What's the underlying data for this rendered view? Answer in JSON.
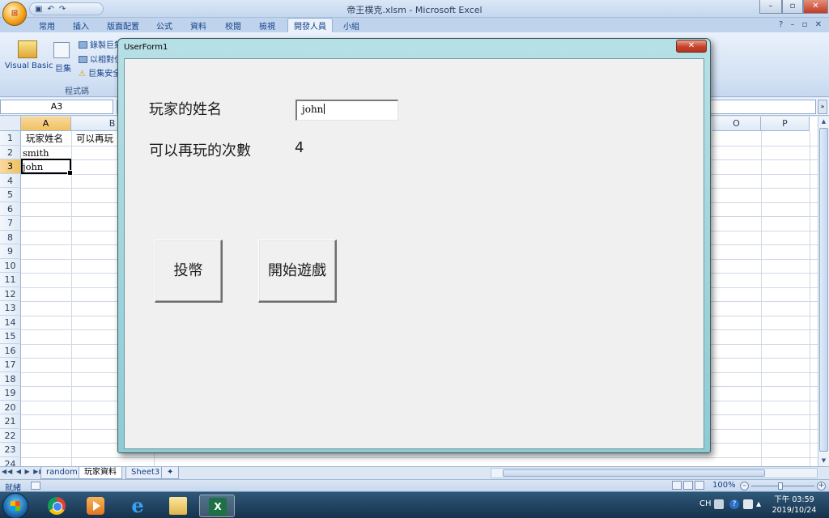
{
  "window": {
    "title": "帝王樸克.xlsm - Microsoft Excel",
    "office_button_label": "Office",
    "qat_icons": [
      "save-icon",
      "undo-icon",
      "redo-icon"
    ],
    "controls": {
      "minimize": "–",
      "maximize": "▫",
      "close": "✕"
    }
  },
  "ribbon": {
    "tabs": [
      "常用",
      "插入",
      "版面配置",
      "公式",
      "資料",
      "校閱",
      "檢視",
      "開發人員",
      "小組"
    ],
    "active_tab": "開發人員",
    "help_icons": "? – ▫ ✕",
    "code_group": {
      "visual_basic_label": "Visual Basic",
      "macros_label": "巨集",
      "record_macro_label": "錄製巨集",
      "relative_ref_label": "以相對位",
      "macro_security_label": "巨集安全",
      "group_label": "程式碼"
    }
  },
  "formula_bar": {
    "name_box": "A3",
    "formula": "",
    "expand_icon": "»"
  },
  "grid": {
    "columns": [
      "A",
      "B",
      "O",
      "P"
    ],
    "selected_column": "A",
    "rows": [
      "1",
      "2",
      "3",
      "4",
      "5",
      "6",
      "7",
      "8",
      "9",
      "10",
      "11",
      "12",
      "13",
      "14",
      "15",
      "16",
      "17",
      "18",
      "19",
      "20",
      "21",
      "22",
      "23",
      "24"
    ],
    "selected_row": "3",
    "cells": {
      "A1": "玩家姓名",
      "B1": "可以再玩",
      "A2": "smith",
      "A3": "john"
    }
  },
  "sheet_tabs": {
    "nav_arrows": "◀◀ ◀ ▶ ▶▶",
    "tabs": [
      "random",
      "玩家資料",
      "Sheet3"
    ],
    "active": "玩家資料",
    "new_sheet_icon": "✦"
  },
  "status_bar": {
    "status": "就緒",
    "zoom": "100%",
    "zoom_minus": "–",
    "zoom_plus": "+"
  },
  "taskbar": {
    "apps": [
      "chrome",
      "media-player",
      "internet-explorer",
      "file-explorer",
      "excel"
    ],
    "ie_glyph": "e",
    "excel_glyph": "X",
    "tray_lang": "CH",
    "tray_help": "?",
    "tray_arrow": "▲",
    "clock_time": "下午 03:59",
    "clock_date": "2019/10/24"
  },
  "userform": {
    "title": "UserForm1",
    "close_label": "✕",
    "name_label": "玩家的姓名",
    "name_value": "john",
    "plays_label": "可以再玩的次數",
    "plays_value": "4",
    "insert_coin_button": "投幣",
    "start_game_button": "開始遊戲"
  }
}
